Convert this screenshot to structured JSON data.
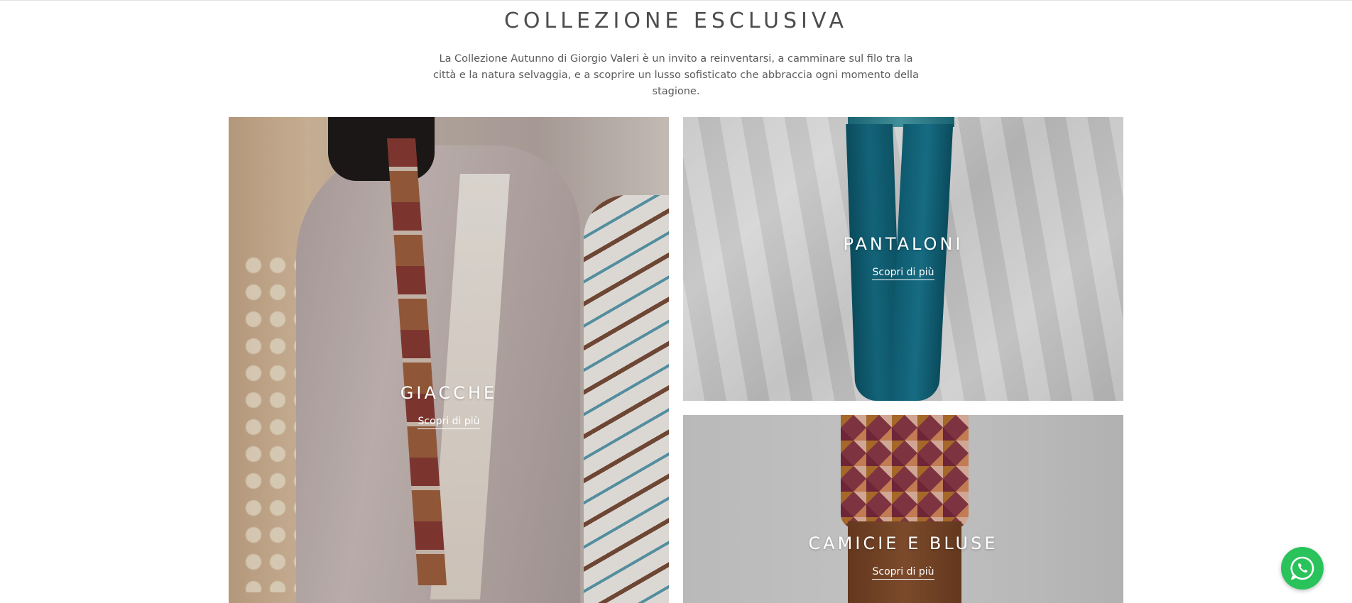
{
  "section": {
    "title": "COLLEZIONE ESCLUSIVA",
    "description": "La Collezione Autunno di Giorgio Valeri è un invito a reinventarsi, a camminare sul filo tra la città e la natura selvaggia, e a scoprire un lusso sofisticato che abbraccia ogni momento della stagione."
  },
  "tiles": [
    {
      "title": "GIACCHE",
      "link": "Scopri di più"
    },
    {
      "title": "PANTALONI",
      "link": "Scopri di più"
    },
    {
      "title": "CAMICIE E BLUSE",
      "link": "Scopri di più"
    }
  ],
  "floating": {
    "icon": "whatsapp-icon",
    "color": "#29c25b"
  },
  "colors": {
    "heading": "#4d4d4d",
    "body_text": "#5a5a5a",
    "caption_text": "#ffffff"
  }
}
